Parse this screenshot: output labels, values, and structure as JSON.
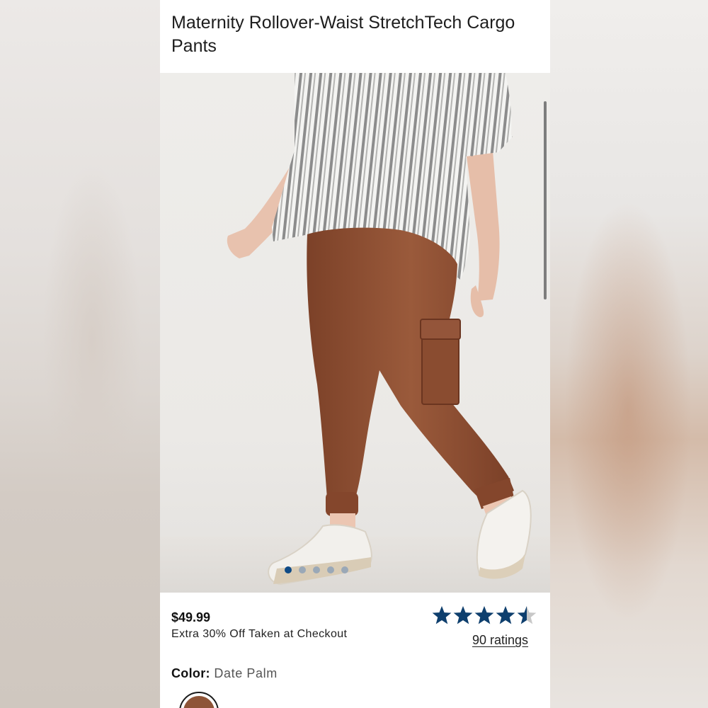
{
  "product": {
    "title": "Maternity Rollover-Waist StretchTech Cargo Pants",
    "price": "$49.99",
    "promo": "Extra 30% Off Taken at Checkout",
    "rating": 4.5,
    "rating_max": 5,
    "ratings_label": "90 ratings",
    "color_label": "Color:",
    "color_value": "Date Palm",
    "swatch_color": "#8e5437"
  },
  "gallery": {
    "image_count": 5,
    "active_index": 0,
    "image_subject": "model-wearing-brown-cargo-pants"
  },
  "colors": {
    "star_fill": "#0e3f6e",
    "star_empty": "#c8c8c8",
    "dot_active": "#0e4a86",
    "dot_inactive": "#9aa8b7"
  }
}
